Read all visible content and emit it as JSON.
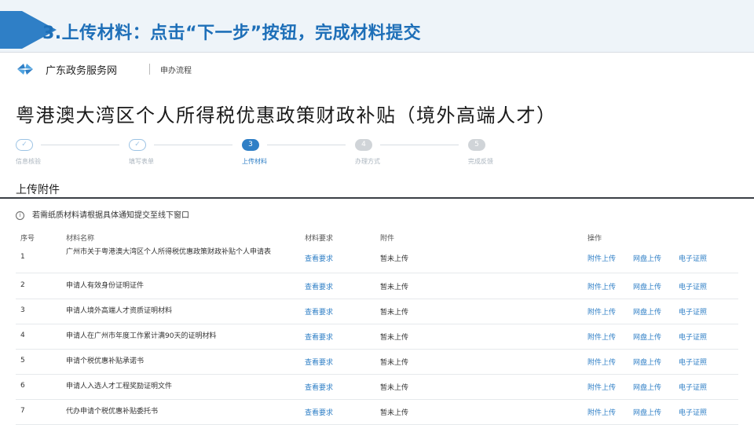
{
  "banner": {
    "title": "3.上传材料：点击“下一步”按钮，完成材料提交"
  },
  "header": {
    "site_name": "广东政务服务网",
    "breadcrumb": "申办流程"
  },
  "page_title": "粤港澳大湾区个人所得税优惠政策财政补贴（境外高端人才）",
  "steps": [
    {
      "label": "信息核验",
      "state": "done",
      "mark": "✓"
    },
    {
      "label": "填写表单",
      "state": "done",
      "mark": "✓"
    },
    {
      "label": "上传材料",
      "state": "current",
      "mark": "3"
    },
    {
      "label": "办理方式",
      "state": "todo",
      "mark": "4"
    },
    {
      "label": "完成反馈",
      "state": "todo",
      "mark": "5"
    }
  ],
  "section": {
    "title": "上传附件"
  },
  "notice": {
    "icon": "info-icon",
    "text": "若需纸质材料请根据具体通知提交至线下窗口"
  },
  "table": {
    "headers": {
      "index": "序号",
      "name": "材料名称",
      "req": "材料要求",
      "attach": "附件",
      "ops": "操作"
    },
    "rows": [
      {
        "index": "1",
        "name": "广州市关于粤港澳大湾区个人所得税优惠政策财政补贴个人申请表",
        "req": "查看要求",
        "attach": "暂未上传",
        "op1": "附件上传",
        "op2": "网盘上传",
        "op3": "电子证照"
      },
      {
        "index": "2",
        "name": "申请人有效身份证明证件",
        "req": "查看要求",
        "attach": "暂未上传",
        "op1": "附件上传",
        "op2": "网盘上传",
        "op3": "电子证照"
      },
      {
        "index": "3",
        "name": "申请人境外高端人才资质证明材料",
        "req": "查看要求",
        "attach": "暂未上传",
        "op1": "附件上传",
        "op2": "网盘上传",
        "op3": "电子证照"
      },
      {
        "index": "4",
        "name": "申请人在广州市年度工作累计满90天的证明材料",
        "req": "查看要求",
        "attach": "暂未上传",
        "op1": "附件上传",
        "op2": "网盘上传",
        "op3": "电子证照"
      },
      {
        "index": "5",
        "name": "申请个税优惠补贴承诺书",
        "req": "查看要求",
        "attach": "暂未上传",
        "op1": "附件上传",
        "op2": "网盘上传",
        "op3": "电子证照"
      },
      {
        "index": "6",
        "name": "申请人入选人才工程奖励证明文件",
        "req": "查看要求",
        "attach": "暂未上传",
        "op1": "附件上传",
        "op2": "网盘上传",
        "op3": "电子证照"
      },
      {
        "index": "7",
        "name": "代办申请个税优惠补贴委托书",
        "req": "查看要求",
        "attach": "暂未上传",
        "op1": "附件上传",
        "op2": "网盘上传",
        "op3": "电子证照"
      }
    ]
  },
  "colors": {
    "accent": "#2f7fc6",
    "banner_bg": "#eef4f9"
  }
}
